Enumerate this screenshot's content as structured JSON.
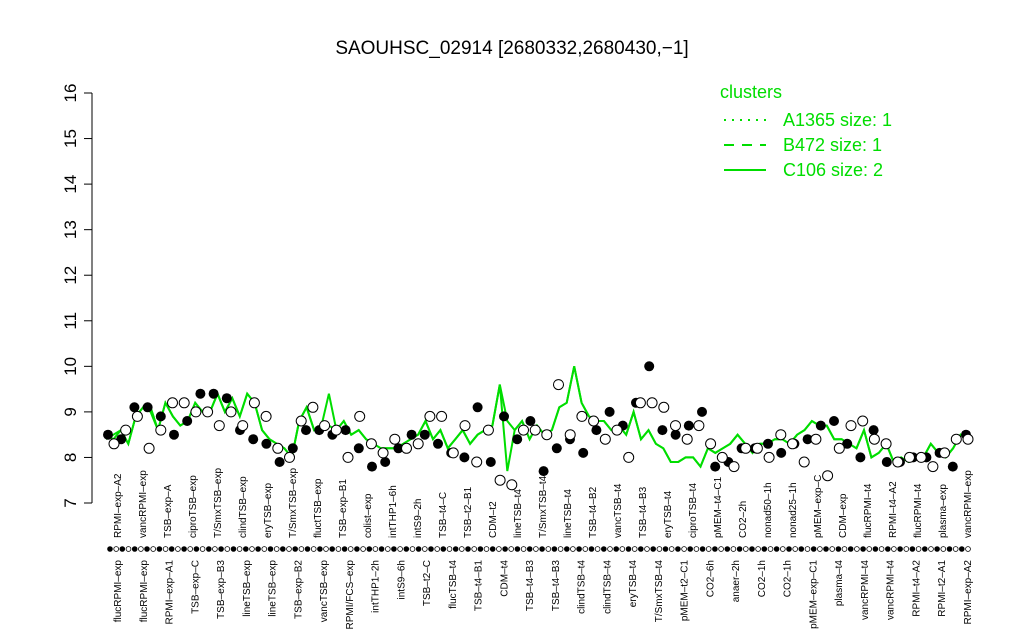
{
  "chart_data": {
    "type": "line",
    "title": "SAOUHSC_02914 [2680332,2680430,−1]",
    "xlabel": "",
    "ylabel": "",
    "ylim": [
      7,
      16
    ],
    "yticks": [
      7,
      8,
      9,
      10,
      11,
      12,
      13,
      14,
      15,
      16
    ],
    "grid": false,
    "legend": {
      "placement": "top-right",
      "title": "clusters",
      "entries": [
        {
          "label": "A1365 size: 1",
          "style": "dotted"
        },
        {
          "label": "B472 size: 1",
          "style": "dashed"
        },
        {
          "label": "C106 size: 2",
          "style": "solid"
        }
      ]
    },
    "colors": {
      "series": "#00dd00",
      "points": "#000000"
    },
    "top_labels": [
      "RPMI–exp–A2",
      "vancRPMI–exp",
      "TSB–exp–A",
      "ciproTSB–exp",
      "T/SmxTSB–exp",
      "clindTSB–exp",
      "eryTSB–exp",
      "T/SmxTSB–exp",
      "fluctTSB–exp",
      "TSB–exp–B1",
      "colist–exp",
      "intTHP1–6h",
      "intS9–2h",
      "TSB–t4–C",
      "TSB–t2–B1",
      "CDM–t2",
      "lineTSB–t4",
      "T/SmxTSB–t4",
      "lineTSB–t4",
      "TSB–t4–B2",
      "vancTSB–t4",
      "TSB–t4–B3",
      "eryTSB–t4",
      "ciproTSB–t4",
      "pMEM–t4–C1",
      "CO2–2h",
      "nonad50–1h",
      "nonad25–1h",
      "pMEM–exp–C",
      "CDM–exp",
      "flucRPMI–t4",
      "RPMI–t4–A2",
      "flucRPMI–t4",
      "plasma–exp",
      "vancRPMI–exp"
    ],
    "bottom_labels": [
      "flucRPMI–exp",
      "flucRPMI–exp",
      "RPMI–exp–A1",
      "TSB–exp–C",
      "TSB–exp–B3",
      "lineTSB–exp",
      "lineTSB–exp",
      "TSB–exp–B2",
      "vancTSB–exp",
      "RPMI/FCS–exp",
      "intTHP1–2h",
      "intS9–6h",
      "TSB–t2–C",
      "flucTSB–t4",
      "TSB–t4–B1",
      "CDM–t4",
      "TSB–t4–B3",
      "TSB–t4–B3",
      "clindTSB–t4",
      "clindTSB–t4",
      "eryTSB–t4",
      "T/SmxTSB–t4",
      "pMEM–t2–C1",
      "CO2–6h",
      "anaer–2h",
      "CO2–1h",
      "CO2–1h",
      "pMEM–exp–C1",
      "plasma–t4",
      "vancRPMI–t4",
      "vancRPMI–t4",
      "RPMI–t4–A2",
      "RPMI–t2–A1",
      "RPMI–exp–A2"
    ],
    "series": [
      {
        "values": [
          8.5,
          8.4,
          8.6,
          8.3,
          8.9,
          9.1,
          9.1,
          8.6,
          9.2,
          8.9,
          8.7,
          8.8,
          9.2,
          9.0,
          9.0,
          9.4,
          9.0,
          9.3,
          8.9,
          9.4,
          9.2,
          8.6,
          8.4,
          8.3,
          8.2,
          8.0,
          8.8,
          9.1,
          8.6,
          8.7,
          8.7,
          8.6,
          8.8,
          8.5,
          8.6,
          8.4,
          8.3,
          8.2,
          8.2,
          8.2,
          8.3,
          8.4,
          8.5,
          8.8,
          8.4,
          8.6,
          8.2,
          8.4,
          8.6,
          8.3,
          8.5,
          8.6,
          8.7,
          9.6,
          8.8,
          8.6,
          8.8,
          8.4,
          8.7,
          8.5,
          8.6,
          9.1,
          9.2,
          10.0,
          9.2,
          8.9,
          8.8,
          8.8,
          8.6,
          8.7,
          8.5,
          9.0,
          8.4,
          8.6,
          8.3,
          8.2,
          7.9,
          7.9,
          8.0,
          8.0,
          7.8,
          8.2,
          8.1,
          8.2,
          8.3,
          8.5,
          8.3,
          8.1,
          8.3,
          8.3,
          8.4,
          8.4,
          8.3,
          8.5,
          8.6,
          8.8,
          8.7,
          8.7,
          8.4,
          8.4,
          8.3,
          8.2,
          8.6,
          8.0,
          8.1,
          8.3,
          7.9,
          8.0,
          7.9,
          8.0,
          8.0,
          8.3,
          8.1,
          8.0,
          8.2,
          8.5,
          8.4
        ]
      },
      {
        "values": [
          8.4,
          8.5,
          8.6,
          8.3,
          8.9,
          9.1,
          9.0,
          8.6,
          9.2,
          8.9,
          8.7,
          8.8,
          9.2,
          9.0,
          9.0,
          9.4,
          9.0,
          9.3,
          8.9,
          9.4,
          9.2,
          8.6,
          8.4,
          8.3,
          8.2,
          8.0,
          8.8,
          9.1,
          8.6,
          8.7,
          9.4,
          8.6,
          8.8,
          8.5,
          8.6,
          8.4,
          8.3,
          8.2,
          8.2,
          8.2,
          8.3,
          8.4,
          8.5,
          8.8,
          8.4,
          8.6,
          8.2,
          8.4,
          8.6,
          8.3,
          8.5,
          8.6,
          8.7,
          9.6,
          7.7,
          8.6,
          8.8,
          8.4,
          8.7,
          8.5,
          8.6,
          9.1,
          9.2,
          10.0,
          9.2,
          8.9,
          8.8,
          8.8,
          8.6,
          8.7,
          8.5,
          9.0,
          8.4,
          8.6,
          8.3,
          8.2,
          7.9,
          7.9,
          8.0,
          8.0,
          7.8,
          8.2,
          8.1,
          8.2,
          8.3,
          8.5,
          8.3,
          8.1,
          8.3,
          8.3,
          8.4,
          8.4,
          8.3,
          8.5,
          8.6,
          8.8,
          8.7,
          8.7,
          8.4,
          8.4,
          8.3,
          8.2,
          8.6,
          8.0,
          8.1,
          8.3,
          7.9,
          8.0,
          7.9,
          8.0,
          8.0,
          8.3,
          8.1,
          8.0,
          8.2,
          8.5,
          8.4
        ]
      }
    ],
    "points": {
      "filled": [
        8.5,
        8.4,
        9.1,
        9.1,
        8.9,
        8.5,
        8.8,
        9.4,
        9.4,
        9.3,
        8.6,
        8.4,
        8.3,
        7.9,
        8.2,
        8.6,
        8.6,
        8.5,
        8.6,
        8.2,
        7.8,
        7.9,
        8.2,
        8.5,
        8.5,
        8.3,
        8.1,
        8.0,
        9.1,
        7.9,
        8.9,
        8.4,
        8.8,
        7.7,
        8.2,
        8.4,
        8.1,
        8.6,
        9.0,
        8.7,
        9.2,
        10.0,
        8.6,
        8.5,
        8.7,
        9.0,
        7.8,
        7.9,
        8.2,
        8.2,
        8.3,
        8.1,
        8.3,
        8.4,
        8.7,
        8.8,
        8.3,
        8.0,
        8.6,
        7.9,
        7.9,
        8.0,
        8.0,
        8.1,
        7.8,
        8.5
      ],
      "open": [
        8.3,
        8.6,
        8.9,
        8.2,
        8.6,
        9.2,
        9.2,
        9.0,
        9.0,
        8.7,
        9.0,
        8.7,
        9.2,
        8.9,
        8.2,
        8.0,
        8.8,
        9.1,
        8.7,
        8.6,
        8.0,
        8.9,
        8.3,
        8.1,
        8.4,
        8.2,
        8.3,
        8.9,
        8.9,
        8.1,
        8.7,
        7.9,
        8.6,
        7.5,
        7.4,
        8.6,
        8.6,
        8.5,
        9.6,
        8.5,
        8.9,
        8.8,
        8.4,
        8.6,
        8.0,
        9.2,
        9.2,
        9.1,
        8.7,
        8.4,
        8.7,
        8.3,
        8.0,
        7.8,
        8.2,
        8.2,
        8.0,
        8.5,
        8.3,
        7.9,
        8.4,
        7.6,
        8.2,
        8.7,
        8.8,
        8.4,
        8.3,
        7.9,
        8.0,
        8.0,
        7.8,
        8.1,
        8.4,
        8.4
      ]
    }
  }
}
